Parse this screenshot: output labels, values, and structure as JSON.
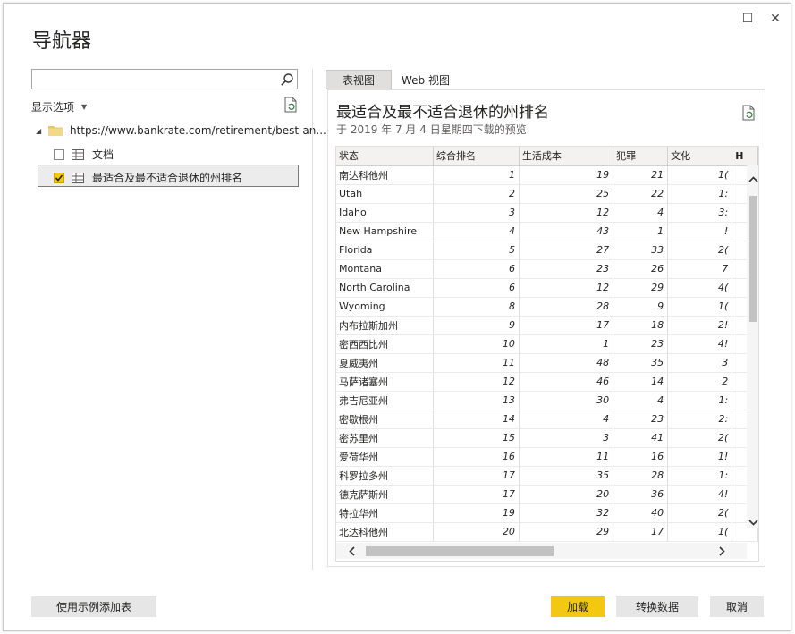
{
  "window": {
    "title": "导航器",
    "maximize_glyph": "☐",
    "close_glyph": "✕"
  },
  "left_pane": {
    "search": {
      "value": "",
      "placeholder": ""
    },
    "display_options": "显示选项",
    "tree": {
      "root": {
        "label": "https://www.bankrate.com/retirement/best-an..."
      },
      "items": [
        {
          "label": "文档",
          "checked": false
        },
        {
          "label": "最适合及最不适合退休的州排名",
          "checked": true,
          "selected": true
        }
      ]
    }
  },
  "right_pane": {
    "tabs": [
      {
        "label": "表视图",
        "active": true
      },
      {
        "label": "Web 视图",
        "active": false
      }
    ],
    "preview": {
      "title": "最适合及最不适合退休的州排名",
      "subtitle": "于 2019 年 7 月 4 日星期四下载的预览",
      "columns": [
        "状态",
        "综合排名",
        "生活成本",
        "犯罪",
        "文化",
        "H"
      ],
      "rows": [
        [
          "南达科他州",
          "1",
          "19",
          "21",
          "1("
        ],
        [
          "Utah",
          "2",
          "25",
          "22",
          "1:"
        ],
        [
          "Idaho",
          "3",
          "12",
          "4",
          "3:"
        ],
        [
          "New Hampshire",
          "4",
          "43",
          "1",
          "!"
        ],
        [
          "Florida",
          "5",
          "27",
          "33",
          "2("
        ],
        [
          "Montana",
          "6",
          "23",
          "26",
          "7"
        ],
        [
          "North Carolina",
          "6",
          "12",
          "29",
          "4("
        ],
        [
          "Wyoming",
          "8",
          "28",
          "9",
          "1("
        ],
        [
          "内布拉斯加州",
          "9",
          "17",
          "18",
          "2!"
        ],
        [
          "密西西比州",
          "10",
          "1",
          "23",
          "4!"
        ],
        [
          "夏威夷州",
          "11",
          "48",
          "35",
          "3"
        ],
        [
          "马萨诸塞州",
          "12",
          "46",
          "14",
          "2"
        ],
        [
          "弗吉尼亚州",
          "13",
          "30",
          "4",
          "1:"
        ],
        [
          "密歇根州",
          "14",
          "4",
          "23",
          "2:"
        ],
        [
          "密苏里州",
          "15",
          "3",
          "41",
          "2("
        ],
        [
          "爱荷华州",
          "16",
          "11",
          "16",
          "1!"
        ],
        [
          "科罗拉多州",
          "17",
          "35",
          "28",
          "1:"
        ],
        [
          "德克萨斯州",
          "17",
          "20",
          "36",
          "4!"
        ],
        [
          "特拉华州",
          "19",
          "32",
          "40",
          "2("
        ],
        [
          "北达科他州",
          "20",
          "29",
          "17",
          "1("
        ]
      ]
    }
  },
  "footer": {
    "add_table_label": "使用示例添加表",
    "load_label": "加载",
    "transform_label": "转换数据",
    "cancel_label": "取消"
  },
  "colors": {
    "accent": "#f2c811",
    "button_bg": "#e6e6e6",
    "folder": "#e8c46b"
  }
}
